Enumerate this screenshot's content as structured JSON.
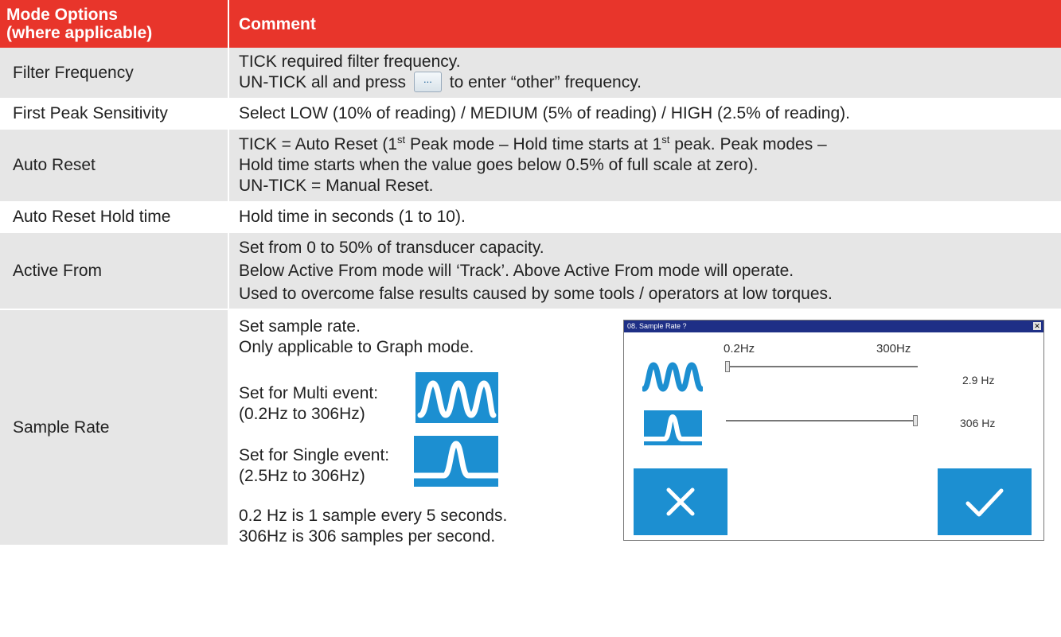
{
  "header": {
    "mode_options": "Mode Options",
    "where_applicable": "(where applicable)",
    "comment": "Comment"
  },
  "rows": {
    "filter_frequency": {
      "label": "Filter Frequency",
      "line1": "TICK required filter frequency.",
      "line2_pre": "UN-TICK all and press",
      "button_text": "...",
      "line2_post": "to enter “other” frequency."
    },
    "first_peak": {
      "label": "First Peak Sensitivity",
      "text": "Select LOW (10% of reading) / MEDIUM (5% of reading) / HIGH (2.5% of reading)."
    },
    "auto_reset": {
      "label": "Auto Reset",
      "l1a": "TICK = Auto Reset (1",
      "l1b": " Peak mode – Hold time starts at 1",
      "l1c": " peak. Peak modes –",
      "st": "st",
      "l2": "Hold time starts when the value goes below 0.5% of full scale at zero).",
      "l3": "UN-TICK = Manual Reset."
    },
    "hold_time": {
      "label": "Auto Reset Hold time",
      "text": "Hold time in seconds (1 to 10)."
    },
    "active_from": {
      "label": "Active From",
      "l1": "Set from 0 to 50% of transducer capacity.",
      "l2": "Below Active From mode will ‘Track’. Above Active From mode will operate.",
      "l3": "Used to overcome false results caused by some tools / operators at low torques."
    },
    "sample_rate": {
      "label": "Sample Rate",
      "l1": "Set sample rate.",
      "l2": "Only applicable to Graph mode.",
      "multi_l1": "Set for Multi event:",
      "multi_l2": "(0.2Hz to 306Hz)",
      "single_l1": "Set for Single event:",
      "single_l2": "(2.5Hz to 306Hz)",
      "note1": "0.2 Hz is 1 sample every 5 seconds.",
      "note2": "306Hz is 306 samples per second."
    }
  },
  "dialog": {
    "title": "08. Sample Rate ?",
    "close": "✕",
    "min_label": "0.2Hz",
    "max_label": "300Hz",
    "multi_value": "2.9 Hz",
    "single_value": "306 Hz",
    "multi_slider_level": 0.01,
    "single_slider_level": 1.0
  },
  "icons": {
    "multi_event": "multi-wave-icon",
    "single_event": "single-peak-icon",
    "cancel": "cross-icon",
    "confirm": "check-icon"
  },
  "colors": {
    "header_bg": "#e8352b",
    "row_shade": "#e6e6e6",
    "icon_blue": "#1c8fd1",
    "dialog_title_bg": "#1e2f86"
  }
}
